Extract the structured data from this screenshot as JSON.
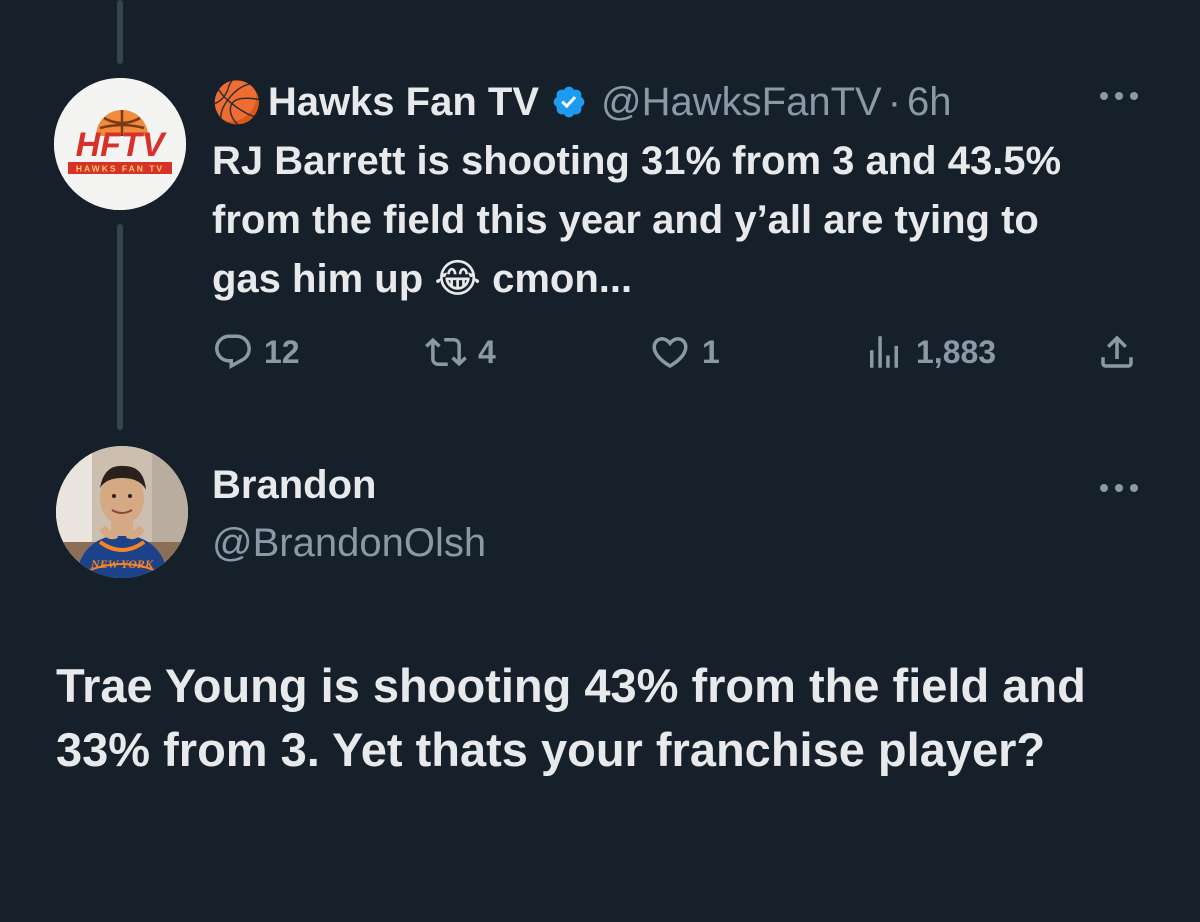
{
  "tweet": {
    "author_emoji": "🏀",
    "display_name": "Hawks Fan TV",
    "handle": "@HawksFanTV",
    "separator": "·",
    "time": "6h",
    "avatar_logo_text": "HFTV",
    "avatar_logo_subtext": "HAWKS FAN TV",
    "text": "RJ Barrett is shooting 31% from 3 and 43.5% from the field this year and y’all are tying to gas him up 😂 cmon...",
    "stats": {
      "replies": "12",
      "retweets": "4",
      "likes": "1",
      "views": "1,883"
    }
  },
  "reply": {
    "display_name": "Brandon",
    "handle": "@BrandonOlsh",
    "jersey_text": "NEW YORK",
    "text": "Trae Young is shooting 43% from the field and 33% from 3. Yet thats your franchise player?"
  },
  "icons": {
    "more": "more-icon",
    "verified": "verified-badge-icon",
    "reply": "reply-icon",
    "retweet": "retweet-icon",
    "like": "like-icon",
    "views": "views-icon",
    "share": "share-icon"
  },
  "colors": {
    "background": "#15202b",
    "text": "#e7e9ea",
    "muted": "#8b98a5",
    "verified": "#1d9bf0",
    "thread_line": "#38444d"
  }
}
